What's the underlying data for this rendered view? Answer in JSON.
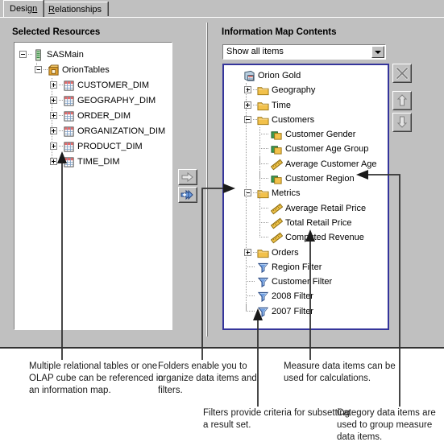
{
  "tabs": [
    {
      "id": "design",
      "label": "Design",
      "accel": "n",
      "active": true
    },
    {
      "id": "relationships",
      "label": "Relationships",
      "accel": "R",
      "active": false
    }
  ],
  "left_panel": {
    "title": "Selected Resources",
    "tree": [
      {
        "label": "SASMain",
        "icon": "server-icon",
        "depth": 0,
        "expander": "minus"
      },
      {
        "label": "OrionTables",
        "icon": "library-icon",
        "depth": 1,
        "expander": "minus"
      },
      {
        "label": "CUSTOMER_DIM",
        "icon": "table-icon",
        "depth": 2,
        "expander": "plus"
      },
      {
        "label": "GEOGRAPHY_DIM",
        "icon": "table-icon",
        "depth": 2,
        "expander": "plus"
      },
      {
        "label": "ORDER_DIM",
        "icon": "table-icon",
        "depth": 2,
        "expander": "plus"
      },
      {
        "label": "ORGANIZATION_DIM",
        "icon": "table-icon",
        "depth": 2,
        "expander": "plus"
      },
      {
        "label": "PRODUCT_DIM",
        "icon": "table-icon",
        "depth": 2,
        "expander": "plus"
      },
      {
        "label": "TIME_DIM",
        "icon": "table-icon",
        "depth": 2,
        "expander": "plus"
      }
    ]
  },
  "right_panel": {
    "title": "Information Map Contents",
    "filter_combo": {
      "value": "Show all items",
      "options": [
        "Show all items"
      ]
    },
    "tree": [
      {
        "label": "Orion Gold",
        "icon": "information-map-icon",
        "depth": 0,
        "expander": "none"
      },
      {
        "label": "Geography",
        "icon": "folder-icon",
        "depth": 1,
        "expander": "plus"
      },
      {
        "label": "Time",
        "icon": "folder-icon",
        "depth": 1,
        "expander": "plus"
      },
      {
        "label": "Customers",
        "icon": "folder-icon",
        "depth": 1,
        "expander": "minus"
      },
      {
        "label": "Customer Gender",
        "icon": "category-item-icon",
        "depth": 2,
        "expander": "none"
      },
      {
        "label": "Customer Age Group",
        "icon": "category-item-icon",
        "depth": 2,
        "expander": "none"
      },
      {
        "label": "Average Customer Age",
        "icon": "measure-item-icon",
        "depth": 2,
        "expander": "none"
      },
      {
        "label": "Customer Region",
        "icon": "category-item-icon",
        "depth": 2,
        "expander": "none"
      },
      {
        "label": "Metrics",
        "icon": "folder-icon",
        "depth": 1,
        "expander": "minus"
      },
      {
        "label": "Average Retail Price",
        "icon": "measure-item-icon",
        "depth": 2,
        "expander": "none"
      },
      {
        "label": "Total Retail Price",
        "icon": "measure-item-icon",
        "depth": 2,
        "expander": "none"
      },
      {
        "label": "Computed Revenue",
        "icon": "measure-item-icon",
        "depth": 2,
        "expander": "none"
      },
      {
        "label": "Orders",
        "icon": "folder-icon",
        "depth": 1,
        "expander": "plus"
      },
      {
        "label": "Region Filter",
        "icon": "filter-icon",
        "depth": 1,
        "expander": "none"
      },
      {
        "label": "Customer Filter",
        "icon": "filter-icon",
        "depth": 1,
        "expander": "none"
      },
      {
        "label": "2008 Filter",
        "icon": "filter-icon",
        "depth": 1,
        "expander": "none"
      },
      {
        "label": "2007 Filter",
        "icon": "filter-icon",
        "depth": 1,
        "expander": "none"
      }
    ]
  },
  "transfer_buttons": [
    {
      "id": "add-one",
      "icon": "arrow-right-icon",
      "enabled": false
    },
    {
      "id": "add-all",
      "icon": "add-all-arrows-icon",
      "enabled": true
    }
  ],
  "side_buttons": [
    {
      "id": "delete",
      "icon": "delete-x-icon",
      "enabled": false
    },
    {
      "id": "up",
      "icon": "arrow-up-icon",
      "enabled": false
    },
    {
      "id": "down",
      "icon": "arrow-down-icon",
      "enabled": false
    }
  ],
  "callouts": [
    {
      "id": "tables",
      "text": "Multiple relational tables or one OLAP cube can be referenced in an information map."
    },
    {
      "id": "folders",
      "text": "Folders enable you to organize data items and filters."
    },
    {
      "id": "measures",
      "text": "Measure data items can be used for calculations."
    },
    {
      "id": "filters",
      "text": "Filters provide criteria for subsetting a result set."
    },
    {
      "id": "category",
      "text": "Category data items are used to group measure data items."
    }
  ],
  "colors": {
    "window_face": "#c0c0c0",
    "tree_background": "#ffffff",
    "focus_border": "#35359b",
    "folder": "#f2c14b",
    "measure": "#e8c44a",
    "category_green": "#3f9b4f",
    "filter_blue": "#5b86d0"
  }
}
